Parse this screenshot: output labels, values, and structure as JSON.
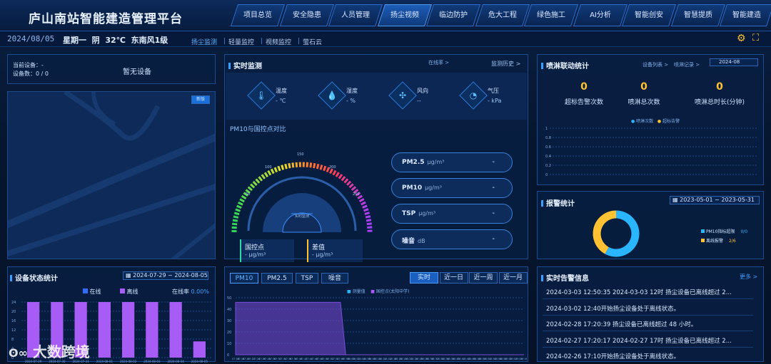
{
  "header": {
    "title": "庐山南站智能建造管理平台",
    "tabs": [
      "项目总览",
      "安全隐患",
      "人员管理",
      "扬尘视频",
      "临边防护",
      "危大工程",
      "绿色施工",
      "AI分析",
      "智能创安",
      "智慧提质",
      "智能建造"
    ],
    "active_tab": "扬尘视频"
  },
  "status": {
    "date": "2024/08/05",
    "weekday": "星期一",
    "weather": "阴",
    "temperature": "32℃",
    "wind": "东南风1级"
  },
  "subtabs": [
    "扬尘监测",
    "轻量监控",
    "视频监控",
    "萤石云"
  ],
  "device": {
    "current_label": "当前设备：",
    "current_value": "-",
    "count_label": "设备数：",
    "count_value": "0 / 0",
    "no_device": "暂无设备"
  },
  "map": {
    "badge": "新版"
  },
  "realtime": {
    "title": "实时监测",
    "online_rate": "在线率 >",
    "history": "监测历史 >",
    "metrics": [
      {
        "icon": "thermometer-icon",
        "glyph": "🌡",
        "label": "温度",
        "value": "- ℃"
      },
      {
        "icon": "humidity-icon",
        "glyph": "💧",
        "label": "湿度",
        "value": "- %"
      },
      {
        "icon": "wind-icon",
        "glyph": "✣",
        "label": "风向",
        "value": "--"
      },
      {
        "icon": "pressure-icon",
        "glyph": "◔",
        "label": "气压",
        "value": "- kPa"
      }
    ],
    "compare_title": "PM10与国控点对比",
    "gauge_ticks": [
      "50",
      "100",
      "150",
      "200",
      "250"
    ],
    "gauge_label": "实时监测",
    "national": {
      "label": "国控点",
      "value": "- μg/m³"
    },
    "diff": {
      "label": "差值",
      "value": "- μg/m³"
    },
    "pills": [
      {
        "label": "PM2.5",
        "unit": "μg/m³",
        "value": "-"
      },
      {
        "label": "PM10",
        "unit": "μg/m³",
        "value": "-"
      },
      {
        "label": "TSP",
        "unit": "μg/m³",
        "value": "-"
      },
      {
        "label": "噪音",
        "unit": "dB",
        "value": "-"
      }
    ]
  },
  "spray": {
    "title": "喷淋联动统计",
    "link1": "设备列表 >",
    "link2": "喷淋记录 >",
    "month": "2024-08",
    "stats": [
      {
        "value": "0",
        "label": "超标告警次数"
      },
      {
        "value": "0",
        "label": "喷淋总次数"
      },
      {
        "value": "0",
        "label": "喷淋总时长(分钟)"
      }
    ],
    "legend": [
      "喷淋次数",
      "超标告警"
    ],
    "yticks": [
      "1",
      "0.8",
      "0.6",
      "0.4",
      "0.2",
      "0"
    ]
  },
  "alarm_stats": {
    "title": "报警统计",
    "range_start": "2023-05-01",
    "range_sep": "~",
    "range_end": "2023-05-31",
    "legend": [
      {
        "name": "PM10指标超限",
        "value": "0/0",
        "color": "#29b6ff"
      },
      {
        "name": "离线报警",
        "value": "2/6",
        "color": "#ffc233"
      }
    ]
  },
  "device_status": {
    "title": "设备状态统计",
    "range_start": "2024-07-29",
    "range_sep": "~",
    "range_end": "2024-08-05",
    "legend_online": "在线",
    "legend_offline": "离线",
    "rate_label": "在线率",
    "rate_value": "0.00%",
    "yticks": [
      "24",
      "20",
      "16",
      "12",
      "8",
      "4",
      "0"
    ]
  },
  "trend": {
    "tabs": [
      "PM10",
      "PM2.5",
      "TSP",
      "噪音"
    ],
    "ranges": [
      "实时",
      "近一日",
      "近一周",
      "近一月"
    ],
    "legend": [
      "测量值",
      "国控点(太阳中学)"
    ],
    "yticks": [
      "50",
      "40",
      "30",
      "20",
      "10",
      "0"
    ]
  },
  "alerts": {
    "title": "实时告警信息",
    "more": "更多 >",
    "items": [
      "2024-03-03 12:50:35 2024-03-03 12时 扬尘设备已离线超过 2...",
      "2024-03-02 12:40开始扬尘设备处于离线状态。",
      "2024-02-28 17:20:39 扬尘设备已离线超过 48 小时。",
      "2024-02-27 17:20:17 2024-02-27 17时 扬尘设备已离线超过 2...",
      "2024-02-26 17:10开始扬尘设备处于离线状态。"
    ]
  },
  "watermark": "大数跨境",
  "chart_data": [
    {
      "type": "bar",
      "title": "设备状态统计",
      "categories": [
        "2024-07-29",
        "2024-07-30",
        "2024-07-31",
        "2024-08-01",
        "2024-08-02",
        "2024-08-03",
        "2024-08-04",
        "2024-08-05"
      ],
      "series": [
        {
          "name": "在线",
          "values": [
            0,
            0,
            0,
            0,
            0,
            0,
            0,
            0
          ],
          "color": "#2f6bff"
        },
        {
          "name": "离线",
          "values": [
            24,
            24,
            24,
            24,
            24,
            24,
            24,
            7
          ],
          "color": "#a65cf5"
        }
      ],
      "ylim": [
        0,
        24
      ]
    },
    {
      "type": "area",
      "title": "PM10",
      "x": [
        "07:16",
        "07:18",
        "07:20",
        "07:22",
        "07:24",
        "07:26",
        "07:28",
        "07:30",
        "07:32",
        "07:34",
        "07:36",
        "07:38",
        "07:40",
        "07:42",
        "07:44",
        "07:46",
        "07:48",
        "07:50",
        "07:52",
        "07:54",
        "07:56",
        "07:58",
        "08:00",
        "08:02",
        "08:04",
        "08:06",
        "08:08",
        "08:10",
        "08:12",
        "08:14",
        "08:16",
        "08:18",
        "08:20",
        "08:22",
        "08:24",
        "08:26",
        "08:28",
        "08:30",
        "08:32",
        "08:34",
        "08:36",
        "08:38",
        "08:40",
        "08:42",
        "08:44",
        "08:46",
        "08:48",
        "08:50",
        "08:52",
        "08:54",
        "08:56",
        "08:58",
        "09:00",
        "09:02",
        "09:04",
        "09:06"
      ],
      "series": [
        {
          "name": "国控点(太阳中学)",
          "values": [
            46,
            46,
            46,
            46,
            46,
            46,
            46,
            46,
            46,
            46,
            46,
            46,
            46,
            46,
            46,
            46,
            46,
            46,
            46,
            46,
            46,
            0,
            0,
            0,
            0,
            0,
            0,
            0,
            0,
            0,
            0,
            0,
            0,
            0,
            0,
            0,
            0,
            0,
            0,
            0,
            0,
            0,
            0,
            0,
            0,
            0,
            0,
            0,
            0,
            0,
            0,
            0,
            0,
            0,
            0,
            0
          ],
          "color": "#7a4bd8"
        }
      ],
      "ylim": [
        0,
        50
      ]
    },
    {
      "type": "pie",
      "title": "报警统计",
      "labels": [
        "PM10指标超限",
        "离线报警"
      ],
      "values": [
        58,
        42
      ],
      "colors": [
        "#29b6ff",
        "#ffc233"
      ]
    }
  ]
}
